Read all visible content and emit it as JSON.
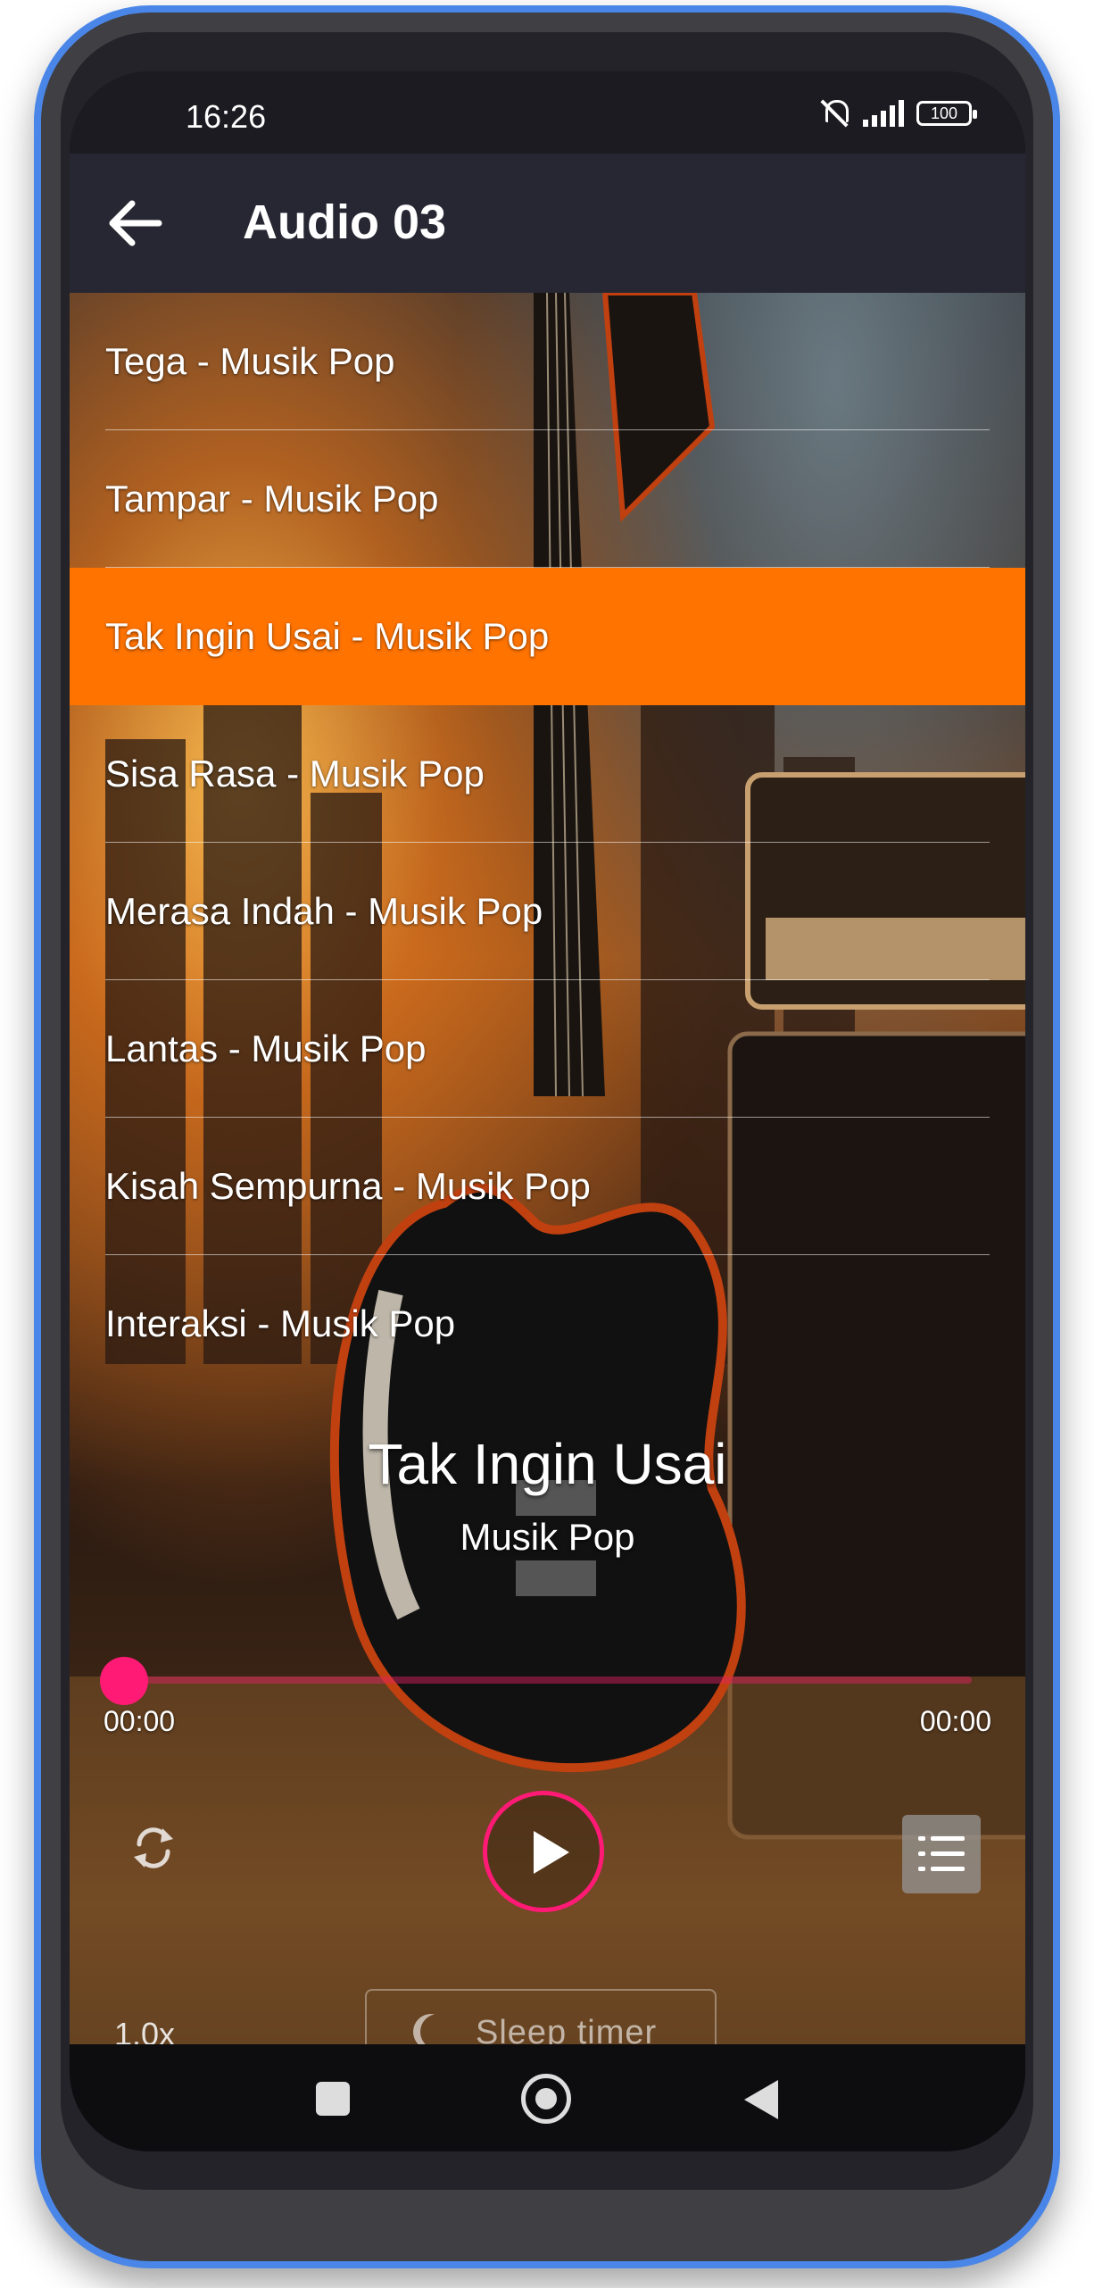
{
  "status_bar": {
    "time": "16:26",
    "battery": "100"
  },
  "app_bar": {
    "title": "Audio 03"
  },
  "tracks": [
    {
      "label": "Tega - Musik Pop"
    },
    {
      "label": "Tampar - Musik Pop"
    },
    {
      "label": "Tak Ingin Usai - Musik Pop"
    },
    {
      "label": "Sisa Rasa - Musik Pop"
    },
    {
      "label": "Merasa Indah - Musik Pop"
    },
    {
      "label": "Lantas - Musik Pop"
    },
    {
      "label": "Kisah Sempurna - Musik Pop"
    },
    {
      "label": "Interaksi - Musik Pop"
    }
  ],
  "selected_track_index": 2,
  "now_playing": {
    "title": "Tak Ingin Usai",
    "artist": "Musik Pop"
  },
  "player": {
    "elapsed": "00:00",
    "duration": "00:00",
    "progress": 0,
    "speed": "1.0x",
    "sleep_timer_label": "Sleep timer"
  },
  "colors": {
    "accent": "#ff1a75",
    "selected_row": "#ff7300",
    "app_bar": "#272733"
  },
  "icons": {
    "back": "arrow-left-icon",
    "repeat": "repeat-icon",
    "play": "play-icon",
    "playlist": "playlist-icon",
    "sleep": "moon-icon"
  }
}
